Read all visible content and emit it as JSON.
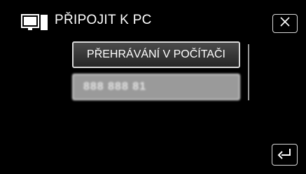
{
  "header": {
    "title": "PŘIPOJIT K PC",
    "icon": "pc-monitor-icon"
  },
  "menu": {
    "items": [
      {
        "label": "PŘEHRÁVÁNÍ V POČÍTAČI",
        "selected": true
      },
      {
        "label": "888 888 81",
        "selected": false
      }
    ]
  },
  "controls": {
    "close_icon": "close-icon",
    "back_icon": "return-icon"
  },
  "colors": {
    "background": "#000000",
    "item_selected": "#3a3a3a",
    "item_default": "#9a9a9a",
    "border": "#d8d8d8"
  }
}
